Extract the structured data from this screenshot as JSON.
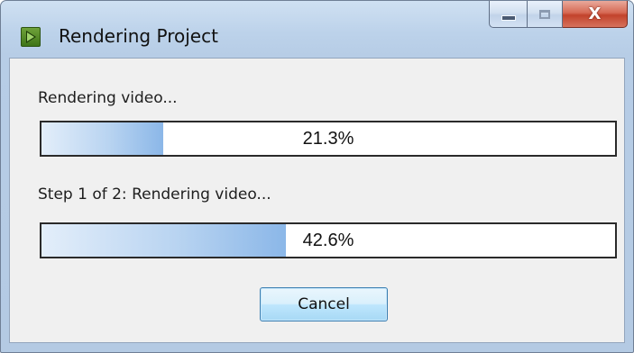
{
  "window": {
    "title": "Rendering Project",
    "app_icon": "render-app-icon",
    "caption_buttons": {
      "minimize_icon": "minimize-icon",
      "maximize_icon": "maximize-icon",
      "close_symbol": "X"
    }
  },
  "progress_1": {
    "label": "Rendering video...",
    "percent_text": "21.3%",
    "value": 0.213
  },
  "progress_2": {
    "label": "Step 1 of 2: Rendering video...",
    "percent_text": "42.6%",
    "value": 0.426
  },
  "buttons": {
    "cancel_label": "Cancel"
  },
  "colors": {
    "progress_fill": "#8bb7e8",
    "close_button": "#c2432c",
    "window_frame": "#b7cde6"
  }
}
